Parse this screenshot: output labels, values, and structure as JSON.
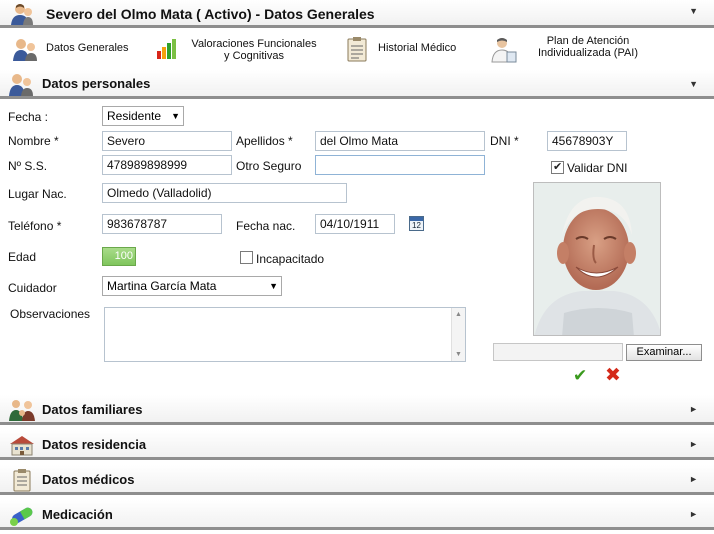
{
  "header": {
    "title": "Severo del Olmo Mata ( Activo) - Datos Generales"
  },
  "toolbar": {
    "datos_generales": "Datos Generales",
    "valoraciones_line1": "Valoraciones Funcionales",
    "valoraciones_line2": "y Cognitivas",
    "historial": "Historial Médico",
    "plan_line1": "Plan de Atención",
    "plan_line2": "Individualizada (PAI)"
  },
  "sections": {
    "personales": "Datos personales",
    "familiares": "Datos familiares",
    "residencia": "Datos residencia",
    "medicos": "Datos médicos",
    "medicacion": "Medicación"
  },
  "form": {
    "fecha_label": "Fecha :",
    "fecha_value": "Residente",
    "nombre_label": "Nombre *",
    "nombre_value": "Severo",
    "apellidos_label": "Apellidos *",
    "apellidos_value": "del Olmo Mata",
    "dni_label": "DNI *",
    "dni_value": "45678903Y",
    "nss_label": "Nº S.S.",
    "nss_value": "478989898999",
    "otro_seguro_label": "Otro Seguro",
    "otro_seguro_value": "",
    "validar_dni_label": "Validar DNI",
    "lugar_label": "Lugar Nac.",
    "lugar_value": "Olmedo (Valladolid)",
    "telefono_label": "Teléfono *",
    "telefono_value": "983678787",
    "fecha_nac_label": "Fecha nac.",
    "fecha_nac_value": "04/10/1911",
    "calendar_day": "12",
    "edad_label": "Edad",
    "edad_value": "100",
    "incapacitado_label": "Incapacitado",
    "cuidador_label": "Cuidador",
    "cuidador_value": "Martina García Mata",
    "observaciones_label": "Observaciones",
    "examinar_label": "Examinar..."
  },
  "colors": {
    "accept": "#3a9a1e",
    "cancel": "#d42a1a",
    "age_fill": "#8ccf6a"
  }
}
